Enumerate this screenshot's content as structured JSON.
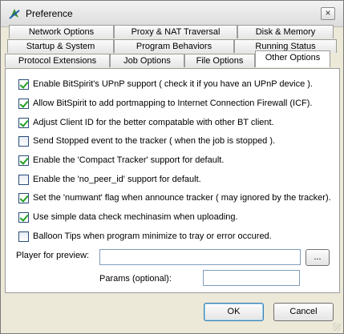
{
  "window": {
    "title": "Preference",
    "close_glyph": "×",
    "icon": "bitspirit-app-icon"
  },
  "tabs": {
    "row1": [
      "Network Options",
      "Proxy & NAT Traversal",
      "Disk & Memory"
    ],
    "row2": [
      "Startup & System",
      "Program Behaviors",
      "Running Status"
    ],
    "row3": [
      "Protocol Extensions",
      "Job Options",
      "File Options",
      "Other Options"
    ],
    "active": "Other Options"
  },
  "options": [
    {
      "label": "Enable BitSpirit's UPnP support ( check it if you have an UPnP device ).",
      "checked": true
    },
    {
      "label": "Allow BitSpirit to add portmapping to Internet Connection Firewall (ICF).",
      "checked": true
    },
    {
      "label": "Adjust Client ID for the better compatable with other BT client.",
      "checked": true
    },
    {
      "label": "Send Stopped event to the tracker ( when the job is stopped ).",
      "checked": false
    },
    {
      "label": "Enable the 'Compact Tracker' support for default.",
      "checked": true
    },
    {
      "label": "Enable the 'no_peer_id' support for default.",
      "checked": false
    },
    {
      "label": "Set the 'numwant' flag when announce tracker ( may ignored by the tracker).",
      "checked": true
    },
    {
      "label": "Use simple data check mechinasim when uploading.",
      "checked": true
    },
    {
      "label": "Balloon Tips when program minimize to tray or error occured.",
      "checked": false
    }
  ],
  "player": {
    "label": "Player for preview:",
    "value": "",
    "browse_label": "..."
  },
  "params": {
    "label": "Params (optional):",
    "value": ""
  },
  "buttons": {
    "ok": "OK",
    "cancel": "Cancel"
  }
}
